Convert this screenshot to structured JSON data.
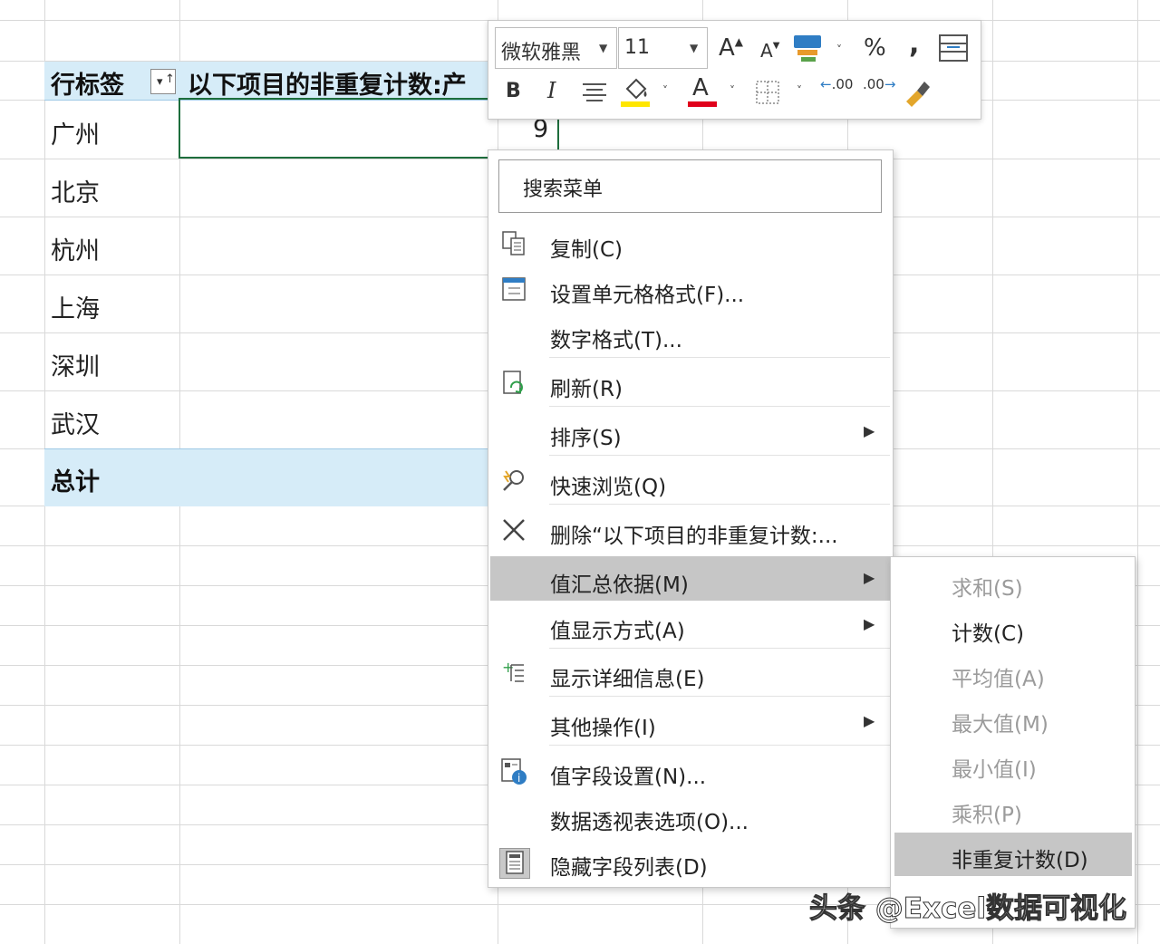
{
  "pivot": {
    "row_label_header": "行标签",
    "value_header": "以下项目的非重复计数:产",
    "rows": [
      "广州",
      "北京",
      "杭州",
      "上海",
      "深圳",
      "武汉"
    ],
    "first_value": "9",
    "total_label": "总计"
  },
  "mini_toolbar": {
    "font_name": "微软雅黑",
    "font_size": "11",
    "grow_font": "A",
    "shrink_font": "A",
    "percent": "%",
    "comma": ",",
    "bold": "B",
    "italic": "I",
    "font_color_letter": "A",
    "font_color": "#e0001b",
    "fill_color": "#ffe600",
    "inc_decimal": ".00",
    "dec_decimal": ".00"
  },
  "context_menu": {
    "search": "搜索菜单",
    "items": [
      {
        "label": "复制(C)",
        "icon": "copy-icon"
      },
      {
        "label": "设置单元格格式(F)...",
        "icon": "format-cells-icon"
      },
      {
        "label": "数字格式(T)...",
        "icon": ""
      },
      {
        "label": "刷新(R)",
        "icon": "refresh-icon"
      },
      {
        "label": "排序(S)",
        "icon": "",
        "submenu": true
      },
      {
        "label": "快速浏览(Q)",
        "icon": "quick-explore-icon"
      },
      {
        "label": "删除“以下项目的非重复计数:...",
        "icon": "delete-icon"
      },
      {
        "label": "值汇总依据(M)",
        "icon": "",
        "submenu": true,
        "highlighted": true
      },
      {
        "label": "值显示方式(A)",
        "icon": "",
        "submenu": true
      },
      {
        "label": "显示详细信息(E)",
        "icon": "show-details-icon"
      },
      {
        "label": "其他操作(I)",
        "icon": "",
        "submenu": true
      },
      {
        "label": "值字段设置(N)...",
        "icon": "field-settings-icon"
      },
      {
        "label": "数据透视表选项(O)...",
        "icon": ""
      },
      {
        "label": "隐藏字段列表(D)",
        "icon": "field-list-icon"
      }
    ]
  },
  "submenu": {
    "items": [
      {
        "label": "求和(S)",
        "enabled": false
      },
      {
        "label": "计数(C)",
        "enabled": true
      },
      {
        "label": "平均值(A)",
        "enabled": false
      },
      {
        "label": "最大值(M)",
        "enabled": false
      },
      {
        "label": "最小值(I)",
        "enabled": false
      },
      {
        "label": "乘积(P)",
        "enabled": false
      },
      {
        "label": "非重复计数(D)",
        "enabled": true,
        "highlighted": true
      }
    ]
  },
  "watermark": "头条 @Excel数据可视化"
}
